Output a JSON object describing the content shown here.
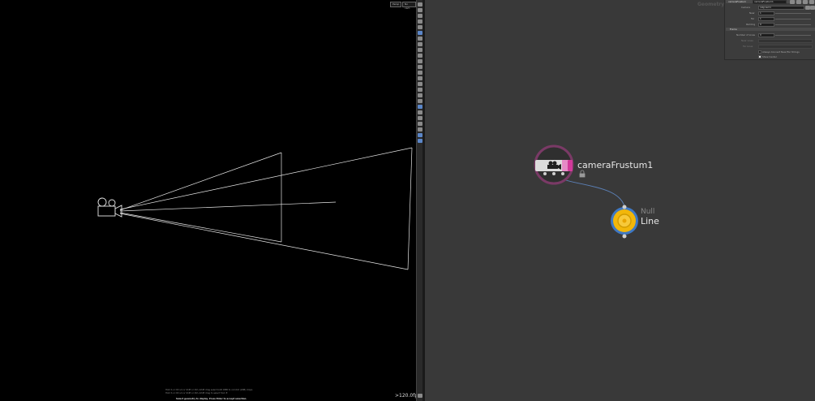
{
  "viewport": {
    "buttons": [
      "Persp",
      "No cam"
    ],
    "fps": ">120.0fps",
    "status_lines": [
      "Hold S or Ctrl+S or Shift or Ctrl+Shift drag select both RMB to commit (LMB) drops",
      "Hold S or Ctrl+S or Shift or Ctrl+Shift drag to select from E",
      "Select geometry to display. Press Enter to accept selection."
    ]
  },
  "network": {
    "context_label": "Geometry",
    "nodes": [
      {
        "name": "cameraFrustum1",
        "locked": true
      },
      {
        "name": "Line",
        "type": "Null"
      }
    ]
  },
  "params": {
    "node_type": "cameraFrustum",
    "node_name": "cameraFrustum1",
    "fields": [
      {
        "label": "Camera",
        "value": "/obj/cam1"
      },
      {
        "label": "Near",
        "value": "1"
      },
      {
        "label": "Far",
        "value": "1"
      },
      {
        "label": "Padding",
        "value": "0"
      }
    ],
    "section": "Frame",
    "frame_fields": [
      {
        "label": "Number of Lines",
        "value": "0"
      },
      {
        "label": "Near Lines",
        "value": ""
      },
      {
        "label": "Far Lines",
        "value": ""
      }
    ],
    "checkboxes": [
      {
        "label": "Always Connect Near/Far Strings",
        "checked": false
      },
      {
        "label": "Show Center",
        "checked": true
      }
    ]
  },
  "colors": {
    "viewport_bg": "#000000",
    "network_bg": "#393939",
    "camera_node_ring": "#7a3a66",
    "null_node": "#f2b70a",
    "null_ring": "#3e78c4",
    "wire": "#5b7fb5"
  }
}
